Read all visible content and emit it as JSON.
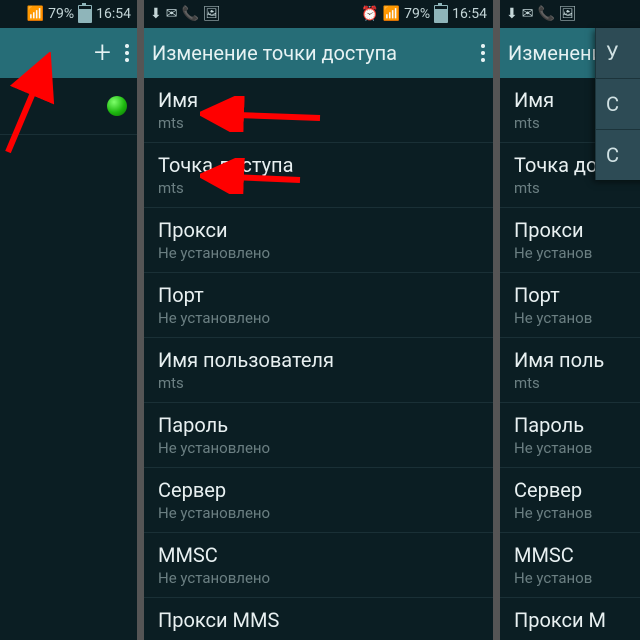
{
  "status": {
    "battery_pct": "79%",
    "time": "16:54"
  },
  "actionbar": {
    "title_edit": "Изменение точки доступа",
    "title_edit_short": "Изменение"
  },
  "phone1": {
    "ap_name": ""
  },
  "settings": [
    {
      "label": "Имя",
      "value": "mts"
    },
    {
      "label": "Точка доступа",
      "value": "mts"
    },
    {
      "label": "Прокси",
      "value": "Не установлено"
    },
    {
      "label": "Порт",
      "value": "Не установлено"
    },
    {
      "label": "Имя пользователя",
      "value": "mts"
    },
    {
      "label": "Пароль",
      "value": "Не установлено"
    },
    {
      "label": "Сервер",
      "value": "Не установлено"
    },
    {
      "label": "MMSC",
      "value": "Не установлено"
    },
    {
      "label": "Прокси MMS",
      "value": ""
    }
  ],
  "settings3": [
    {
      "label": "Имя",
      "value": "mts"
    },
    {
      "label": "Точка до",
      "value": "mts"
    },
    {
      "label": "Прокси",
      "value": "Не установ"
    },
    {
      "label": "Порт",
      "value": "Не установ"
    },
    {
      "label": "Имя поль",
      "value": "mts"
    },
    {
      "label": "Пароль",
      "value": "Не установ"
    },
    {
      "label": "Сервер",
      "value": "Не установ"
    },
    {
      "label": "MMSC",
      "value": "Не установ"
    },
    {
      "label": "Прокси M",
      "value": ""
    }
  ],
  "dropdown": {
    "items": [
      "У",
      "С",
      "С"
    ]
  },
  "icons": {
    "wifi": "📶",
    "signal": "▮▮▮",
    "alarm": "⏰",
    "msg": "✉",
    "phone": "📞",
    "pic": "🖼",
    "dl": "⬇"
  }
}
